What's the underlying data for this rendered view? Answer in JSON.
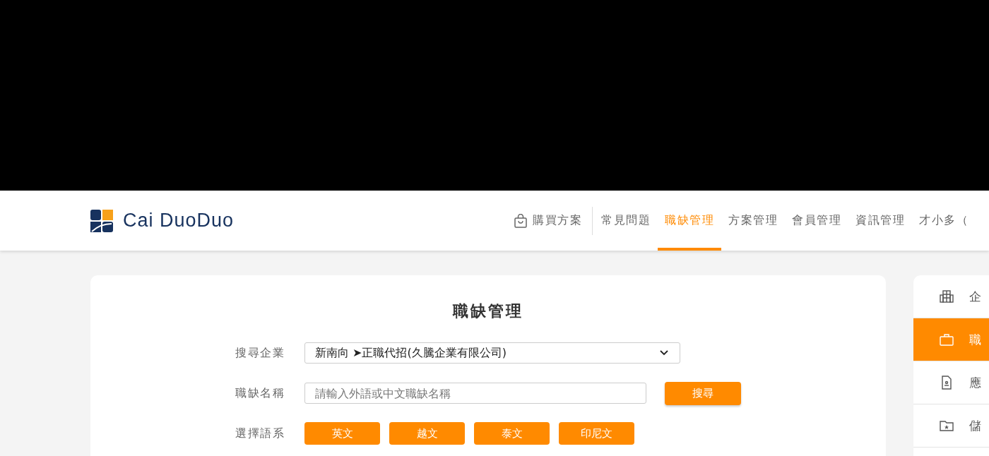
{
  "header": {
    "logo": "Cai DuoDuo",
    "nav": [
      {
        "label": "購買方案",
        "kind": "shop",
        "selected": false
      },
      {
        "label": "常見問題",
        "kind": "link",
        "selected": false
      },
      {
        "label": "職缺管理",
        "kind": "link",
        "selected": true
      },
      {
        "label": "方案管理",
        "kind": "link",
        "selected": false
      },
      {
        "label": "會員管理",
        "kind": "link",
        "selected": false
      },
      {
        "label": "資訊管理",
        "kind": "link",
        "selected": false
      },
      {
        "label": "才小多（",
        "kind": "link",
        "selected": false
      }
    ]
  },
  "form": {
    "title": "職缺管理",
    "company": {
      "label": "搜尋企業",
      "value": "新南向 ➤正職代招(久騰企業有限公司)"
    },
    "job": {
      "label": "職缺名稱",
      "placeholder": "請輸入外語或中文職缺名稱",
      "button": "搜尋"
    },
    "language": {
      "label": "選擇語系",
      "options": [
        "英文",
        "越文",
        "泰文",
        "印尼文"
      ]
    }
  },
  "sidebar": {
    "items": [
      {
        "label": "企",
        "kind": "building",
        "selected": false
      },
      {
        "label": "職",
        "kind": "briefcase",
        "selected": true
      },
      {
        "label": "應",
        "kind": "document",
        "selected": false
      },
      {
        "label": "儲",
        "kind": "folder",
        "selected": false
      }
    ]
  }
}
